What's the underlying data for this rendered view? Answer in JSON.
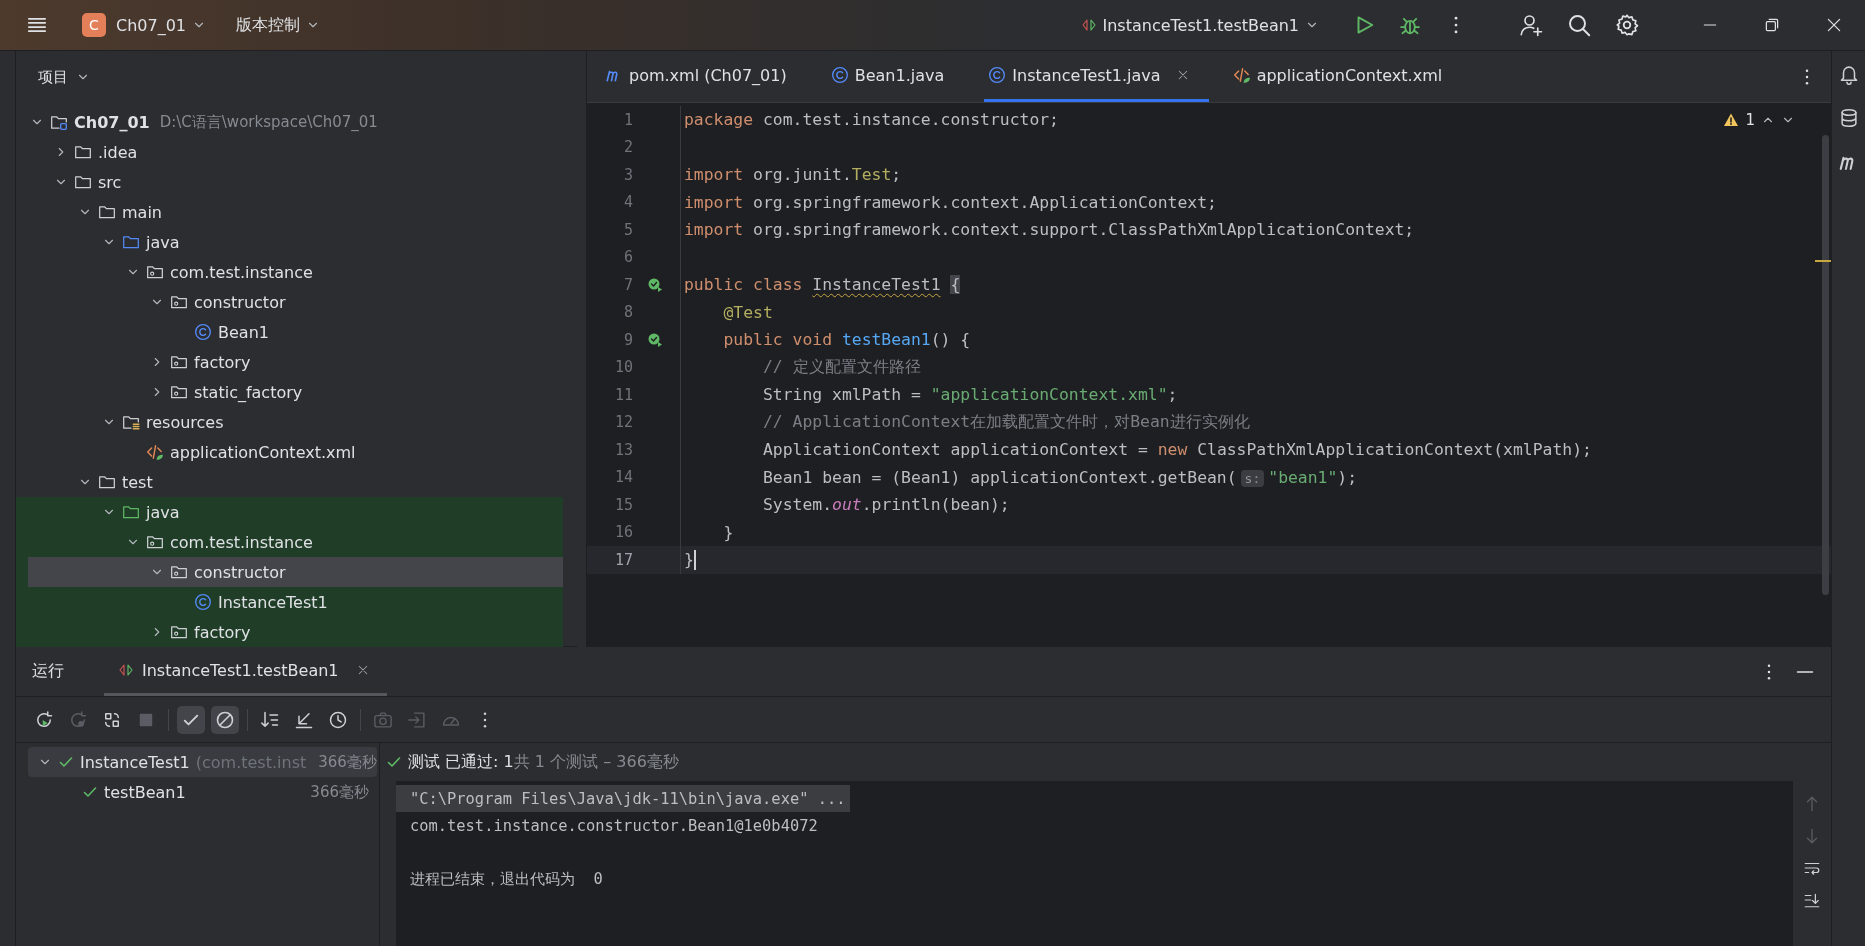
{
  "title_bar": {
    "project_badge": "C",
    "project": "Ch07_01",
    "vcs": "版本控制",
    "run_config": "InstanceTest1.testBean1"
  },
  "project_panel": {
    "title": "项目",
    "tree": [
      {
        "label": "Ch07_01",
        "kind": "module",
        "path": "D:\\C语言\\workspace\\Ch07_01",
        "expanded": true,
        "selected": false,
        "highlighted": false,
        "children": [
          {
            "label": ".idea",
            "kind": "folder",
            "expanded": false,
            "selected": false,
            "highlighted": false
          },
          {
            "label": "src",
            "kind": "folder",
            "expanded": true,
            "selected": false,
            "highlighted": false,
            "children": [
              {
                "label": "main",
                "kind": "folder",
                "expanded": true,
                "selected": false,
                "highlighted": false,
                "children": [
                  {
                    "label": "java",
                    "kind": "source",
                    "expanded": true,
                    "selected": false,
                    "highlighted": false,
                    "children": [
                      {
                        "label": "com.test.instance",
                        "kind": "package",
                        "expanded": true,
                        "selected": false,
                        "highlighted": false,
                        "children": [
                          {
                            "label": "constructor",
                            "kind": "package",
                            "expanded": true,
                            "selected": false,
                            "highlighted": false,
                            "children": [
                              {
                                "label": "Bean1",
                                "kind": "class",
                                "selected": false,
                                "highlighted": false
                              }
                            ]
                          },
                          {
                            "label": "factory",
                            "kind": "package",
                            "expanded": false,
                            "selected": false,
                            "highlighted": false
                          },
                          {
                            "label": "static_factory",
                            "kind": "package",
                            "expanded": false,
                            "selected": false,
                            "highlighted": false
                          }
                        ]
                      }
                    ]
                  },
                  {
                    "label": "resources",
                    "kind": "resources",
                    "expanded": true,
                    "selected": false,
                    "highlighted": false,
                    "children": [
                      {
                        "label": "applicationContext.xml",
                        "kind": "xml",
                        "selected": false,
                        "highlighted": false
                      }
                    ]
                  }
                ]
              },
              {
                "label": "test",
                "kind": "folder",
                "expanded": true,
                "selected": false,
                "highlighted": false,
                "children": [
                  {
                    "label": "java",
                    "kind": "test",
                    "expanded": true,
                    "selected": false,
                    "highlighted": true,
                    "children": [
                      {
                        "label": "com.test.instance",
                        "kind": "package",
                        "expanded": true,
                        "selected": false,
                        "highlighted": true,
                        "children": [
                          {
                            "label": "constructor",
                            "kind": "package",
                            "expanded": true,
                            "selected": true,
                            "highlighted": true,
                            "children": [
                              {
                                "label": "InstanceTest1",
                                "kind": "class",
                                "selected": false,
                                "highlighted": true
                              }
                            ]
                          },
                          {
                            "label": "factory",
                            "kind": "package",
                            "expanded": false,
                            "selected": false,
                            "highlighted": true
                          }
                        ]
                      }
                    ]
                  }
                ]
              }
            ]
          }
        ]
      }
    ]
  },
  "editor": {
    "tabs": [
      {
        "label": "pom.xml (Ch07_01)",
        "kind": "maven",
        "selected": false
      },
      {
        "label": "Bean1.java",
        "kind": "class",
        "selected": false
      },
      {
        "label": "InstanceTest1.java",
        "kind": "class",
        "selected": true
      },
      {
        "label": "applicationContext.xml",
        "kind": "xml",
        "selected": false
      }
    ],
    "warning_count": "1",
    "lines": [
      {
        "number": "1",
        "run_marker": false,
        "current": false,
        "tokens": [
          {
            "kind": "keyword",
            "text": "package"
          },
          {
            "kind": "plain",
            "text": " com.test.instance.constructor;"
          }
        ]
      },
      {
        "number": "2",
        "run_marker": false,
        "current": false
      },
      {
        "number": "3",
        "run_marker": false,
        "current": false,
        "tokens": [
          {
            "kind": "keyword",
            "text": "import"
          },
          {
            "kind": "plain",
            "text": " org.junit."
          },
          {
            "kind": "annotation",
            "text": "Test"
          },
          {
            "kind": "plain",
            "text": ";"
          }
        ]
      },
      {
        "number": "4",
        "run_marker": false,
        "current": false,
        "tokens": [
          {
            "kind": "keyword",
            "text": "import"
          },
          {
            "kind": "plain",
            "text": " org.springframework.context.ApplicationContext;"
          }
        ]
      },
      {
        "number": "5",
        "run_marker": false,
        "current": false,
        "tokens": [
          {
            "kind": "keyword",
            "text": "import"
          },
          {
            "kind": "plain",
            "text": " org.springframework.context.support.ClassPathXmlApplicationContext;"
          }
        ]
      },
      {
        "number": "6",
        "run_marker": false,
        "current": false
      },
      {
        "number": "7",
        "run_marker": true,
        "current": false,
        "tokens": [
          {
            "kind": "keyword",
            "text": "public class "
          },
          {
            "kind": "warning",
            "text": "InstanceTest1"
          },
          {
            "kind": "brace",
            "text": "{"
          }
        ]
      },
      {
        "number": "8",
        "run_marker": false,
        "current": false,
        "tokens": [
          {
            "kind": "annotation",
            "text": "    @Test"
          }
        ]
      },
      {
        "number": "9",
        "run_marker": true,
        "current": false,
        "tokens": [
          {
            "kind": "keyword",
            "text": "    public void "
          },
          {
            "kind": "method",
            "text": "testBean1"
          },
          {
            "kind": "plain",
            "text": "() {"
          }
        ]
      },
      {
        "number": "10",
        "run_marker": false,
        "current": false,
        "tokens": [
          {
            "kind": "comment",
            "text": "        // 定义配置文件路径"
          }
        ]
      },
      {
        "number": "11",
        "run_marker": false,
        "current": false,
        "tokens": [
          {
            "kind": "plain",
            "text": "        String xmlPath = "
          },
          {
            "kind": "string",
            "text": "\"applicationContext.xml\""
          },
          {
            "kind": "plain",
            "text": ";"
          }
        ]
      },
      {
        "number": "12",
        "run_marker": false,
        "current": false,
        "tokens": [
          {
            "kind": "comment",
            "text": "        // ApplicationContext在加载配置文件时，对Bean进行实例化"
          }
        ]
      },
      {
        "number": "13",
        "run_marker": false,
        "current": false,
        "tokens": [
          {
            "kind": "plain",
            "text": "        ApplicationContext applicationContext = "
          },
          {
            "kind": "keyword",
            "text": "new"
          },
          {
            "kind": "plain",
            "text": " ClassPathXmlApplicationContext(xmlPath);"
          }
        ]
      },
      {
        "number": "14",
        "run_marker": false,
        "current": false,
        "tokens": [
          {
            "kind": "plain",
            "text": "        Bean1 bean = (Bean1) applicationContext.getBean("
          },
          {
            "kind": "hint",
            "text": "s:"
          },
          {
            "kind": "string",
            "text": "\"bean1\""
          },
          {
            "kind": "plain",
            "text": ");"
          }
        ]
      },
      {
        "number": "15",
        "run_marker": false,
        "current": false,
        "tokens": [
          {
            "kind": "plain",
            "text": "        System."
          },
          {
            "kind": "static",
            "text": "out"
          },
          {
            "kind": "plain",
            "text": ".println(bean);"
          }
        ]
      },
      {
        "number": "16",
        "run_marker": false,
        "current": false,
        "tokens": [
          {
            "kind": "plain",
            "text": "    }"
          }
        ]
      },
      {
        "number": "17",
        "run_marker": false,
        "current": true,
        "tokens": [
          {
            "kind": "plain",
            "text": "}"
          }
        ]
      }
    ]
  },
  "run_panel": {
    "title": "运行",
    "tabs": [
      {
        "label": "InstanceTest1.testBean1",
        "selected": true
      }
    ],
    "toolbar": [
      {
        "kind": "rerun",
        "on": false,
        "disabled": false
      },
      {
        "kind": "rerun-failed",
        "on": false,
        "disabled": true
      },
      {
        "kind": "toggle-auto",
        "on": false,
        "disabled": false
      },
      {
        "kind": "stop",
        "on": false,
        "disabled": true
      },
      {
        "kind": "show-passed",
        "on": true,
        "disabled": false
      },
      {
        "kind": "show-ignored",
        "on": true,
        "disabled": false
      },
      {
        "kind": "sort",
        "on": false,
        "disabled": false
      },
      {
        "kind": "collapse",
        "on": false,
        "disabled": false
      },
      {
        "kind": "history",
        "on": false,
        "disabled": false
      },
      {
        "kind": "camera",
        "on": false,
        "disabled": true
      },
      {
        "kind": "export",
        "on": false,
        "disabled": true
      },
      {
        "kind": "gauge",
        "on": false,
        "disabled": true
      },
      {
        "kind": "more",
        "on": false,
        "disabled": false
      }
    ],
    "test_tree": [
      {
        "label": "InstanceTest1",
        "detail": "(com.test.inst",
        "time": "366毫秒",
        "passed": true,
        "expanded": true,
        "selected": true,
        "children": [
          {
            "label": "testBean1",
            "time": "366毫秒",
            "passed": true,
            "selected": false
          }
        ]
      }
    ],
    "summary": {
      "status": "测试 已通过: 1",
      "detail": "共 1 个测试 – 366毫秒",
      "passed": true
    },
    "console": [
      {
        "kind": "command",
        "text": "\"C:\\Program Files\\Java\\jdk-11\\bin\\java.exe\" ..."
      },
      {
        "kind": "output",
        "text": "com.test.instance.constructor.Bean1@1e0b4072"
      },
      {
        "kind": "exit",
        "text": "进程已结束，退出代码为  0"
      }
    ]
  }
}
